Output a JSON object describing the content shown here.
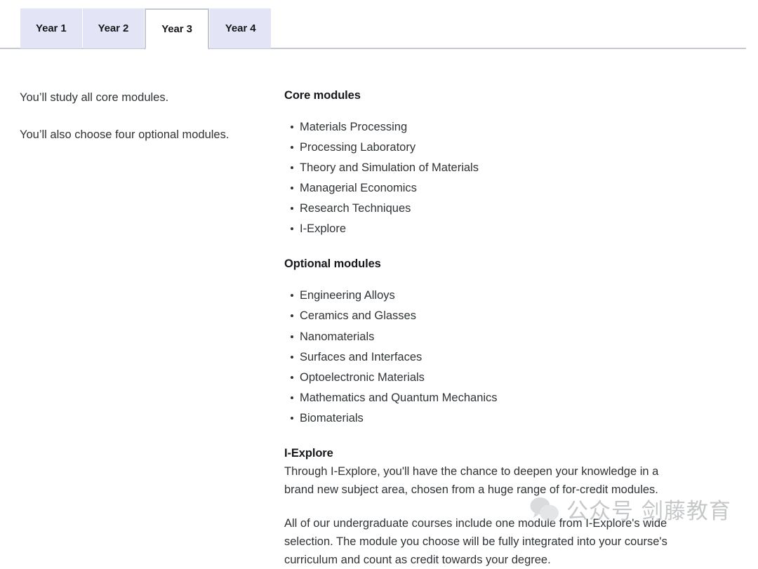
{
  "tabs": {
    "items": [
      {
        "label": "Year 1",
        "active": false
      },
      {
        "label": "Year 2",
        "active": false
      },
      {
        "label": "Year 3",
        "active": true
      },
      {
        "label": "Year 4",
        "active": false
      }
    ],
    "active_index": 2
  },
  "left_column": {
    "paragraphs": [
      "You’ll study all core modules.",
      "You’ll also choose four optional modules."
    ]
  },
  "right_column": {
    "core": {
      "heading": "Core modules",
      "items": [
        "Materials Processing",
        "Processing Laboratory",
        "Theory and Simulation of Materials",
        "Managerial Economics",
        "Research Techniques",
        "I-Explore"
      ]
    },
    "optional": {
      "heading": "Optional modules",
      "items": [
        "Engineering Alloys",
        "Ceramics and Glasses",
        "Nanomaterials",
        "Surfaces and Interfaces",
        "Optoelectronic Materials",
        "Mathematics and Quantum Mechanics",
        "Biomaterials"
      ]
    },
    "iexplore": {
      "heading": "I-Explore",
      "paragraph_1": "Through I-Explore, you'll have the chance to deepen your knowledge in a brand new subject area, chosen from a huge range of for-credit modules.",
      "paragraph_2": "All of our undergraduate courses include one module from I-Explore's wide selection. The module you choose will be fully integrated into your course's curriculum and count as credit towards your degree."
    }
  },
  "watermark": {
    "icon": "wechat-icon",
    "text": "公众号  剑藤教育"
  },
  "colors": {
    "tab_inactive_bg": "#e3e4f6",
    "tab_active_bg": "#ffffff",
    "tab_border": "#c5c9d4",
    "rule": "#c5c9d4",
    "heading_text": "#15171a",
    "body_text": "#2f3336",
    "watermark_text": "#b9bbbd"
  }
}
